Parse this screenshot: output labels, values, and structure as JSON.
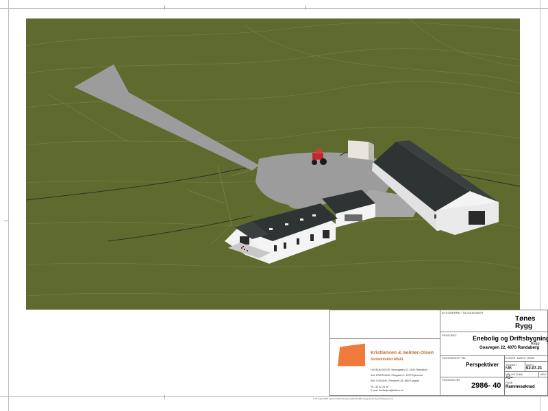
{
  "title_block": {
    "client_label": "BYGGHERRE / TILTAKSHAVER",
    "client_name": "Tønes Rygg",
    "project_label": "PROSJEKT",
    "project_name": "Enebolig og Driftsbygning Tønes",
    "project_name_cont": "Rygg",
    "project_address": "Goavegen 22, 4070 Randaberg",
    "drawing_title_label": "TEGNINGSTITTEL",
    "drawing_title": "Perspektiver",
    "control_label": "KONTR. DATO / SIGN",
    "drawn_label": "TEGNET",
    "drawn_value": "MB",
    "date_label": "DATO",
    "date_value": "02.07.21",
    "scale_label": "MÅLESTOKK",
    "scale_value": "A3=",
    "rev_label": "REV",
    "drawing_no_label": "TEGNING NR",
    "drawing_no": "2986- 40",
    "phase_label": "FASE",
    "phase_value": "Rammesøknad"
  },
  "firm": {
    "name": "Kristiansen & Selmer-Olsen",
    "subtitle": "Sivilarkitekter MNAL",
    "address_lines": [
      "HOVEDKONTOR: Strandgaten 32, 4400 Flekkefjord",
      "Avd. EGERSUND: Elvegaten 2, 4370 Egersund",
      "Avd. LYNGDAL: Fiboveien 28, 4580 Lyngdal",
      "Tlf.: 38 32 78 00",
      "E-post: flekkefjord@arkkso.no"
    ],
    "logo_color": "#f07a3c"
  },
  "footer": {
    "file_path": "K:\\Prosjekt\\2986 Egersund\\Arbeidstegning\\Revit\\2986_Rygg_Enebolig_Driftsbygning.rvt"
  },
  "colors": {
    "terrain": "#5f6a2e",
    "road": "#9c9c9c",
    "roof": "#2e3434",
    "wall": "#f4f4f4",
    "accent": "#f07a3c"
  }
}
